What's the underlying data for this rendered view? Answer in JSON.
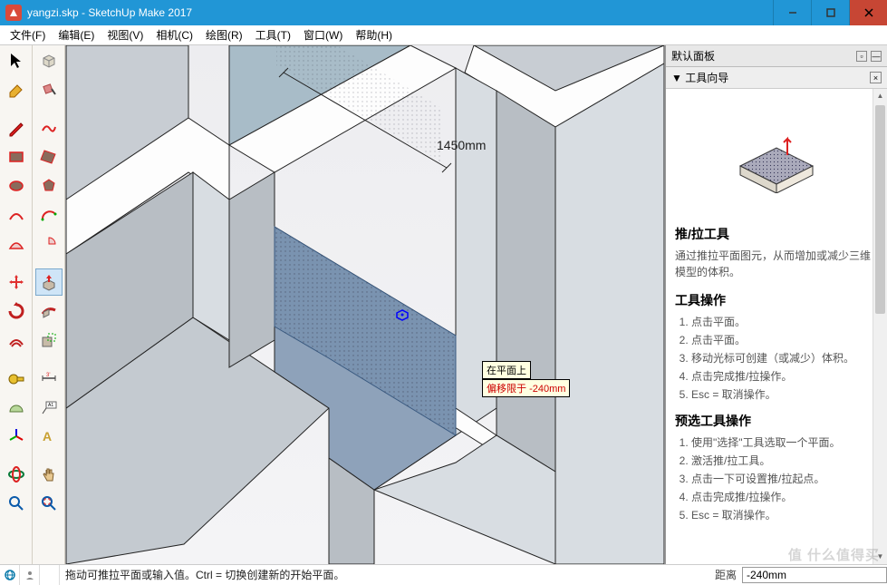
{
  "titlebar": {
    "filename": "yangzi.skp",
    "appname": "SketchUp Make 2017"
  },
  "menu": {
    "file": "文件(F)",
    "edit": "编辑(E)",
    "view": "视图(V)",
    "camera": "相机(C)",
    "draw": "绘图(R)",
    "tools": "工具(T)",
    "window": "窗口(W)",
    "help": "帮助(H)"
  },
  "viewport": {
    "dimension": "1450mm",
    "tooltip_face": "在平面上",
    "tooltip_offset_label": "偏移限于",
    "tooltip_offset_value": "-240mm"
  },
  "panel": {
    "default_title": "默认面板",
    "subtitle_prefix": "▼",
    "subtitle": "工具向导",
    "tool_name": "推/拉工具",
    "tool_desc": "通过推拉平面图元，从而增加或减少三维模型的体积。",
    "ops_title": "工具操作",
    "ops": [
      "点击平面。",
      "点击平面。",
      "移动光标可创建（或减少）体积。",
      "点击完成推/拉操作。",
      "Esc = 取消操作。"
    ],
    "preops_title": "预选工具操作",
    "preops": [
      "使用\"选择\"工具选取一个平面。",
      "激活推/拉工具。",
      "点击一下可设置推/拉起点。",
      "点击完成推/拉操作。",
      "Esc = 取消操作。"
    ]
  },
  "statusbar": {
    "hint": "拖动可推拉平面或输入值。Ctrl = 切换创建新的开始平面。",
    "measure_label": "距离",
    "measure_value": "-240mm"
  },
  "watermark": "值 什么值得买"
}
